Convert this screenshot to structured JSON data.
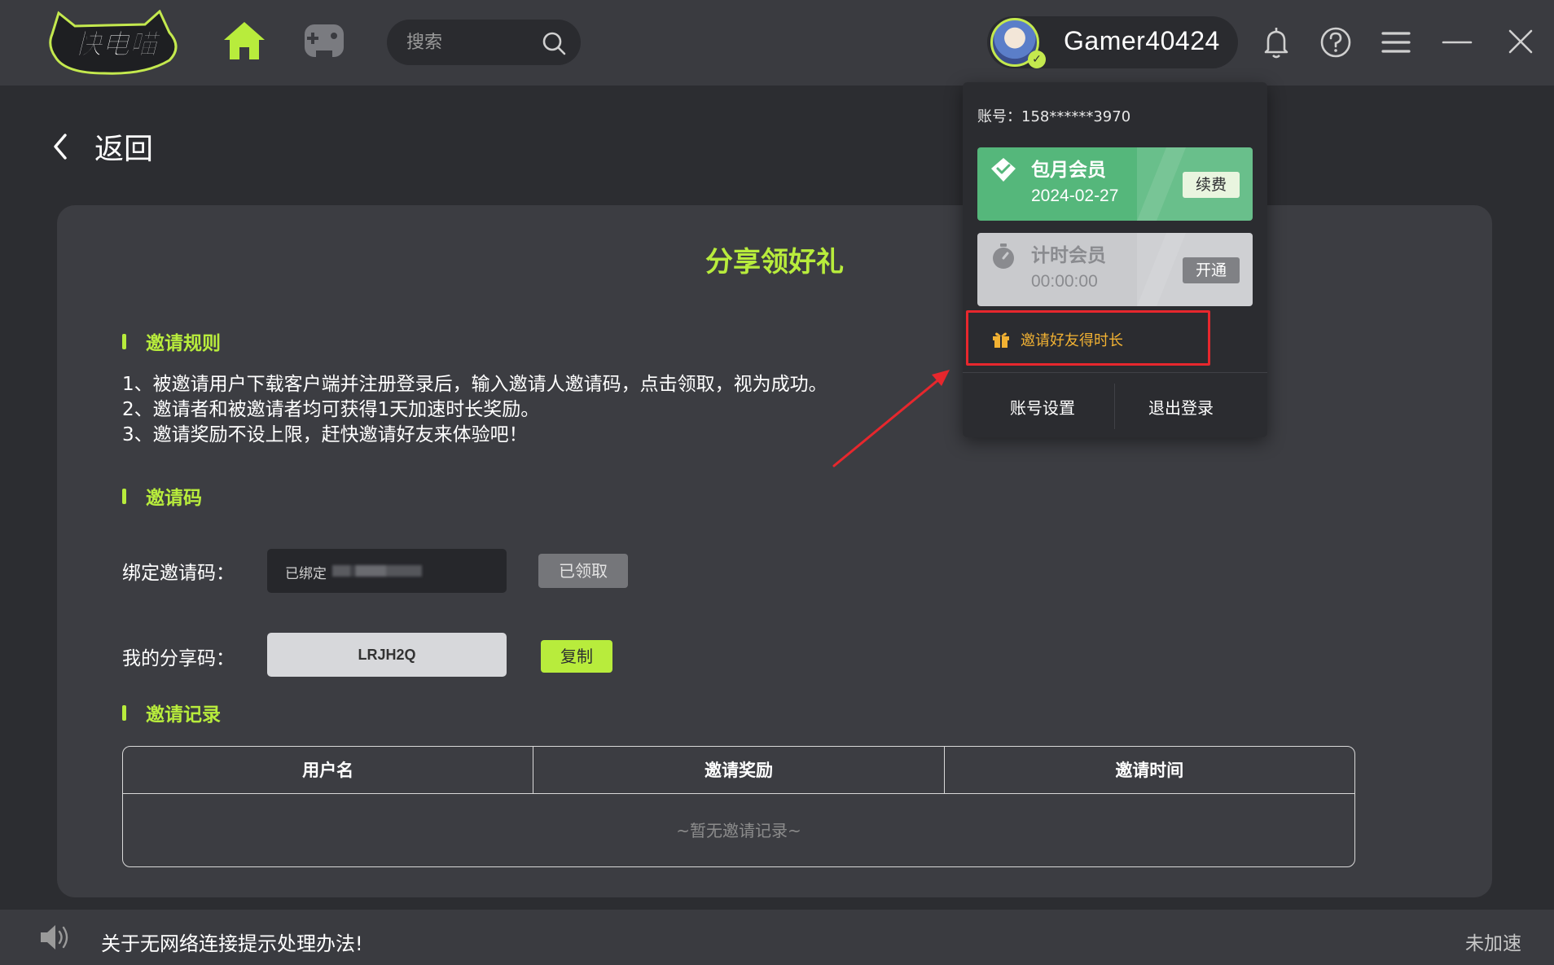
{
  "header": {
    "logo_text": "快电喵",
    "search_placeholder": "搜索",
    "username": "Gamer40424"
  },
  "back": {
    "label": "返回"
  },
  "page": {
    "title": "分享领好礼",
    "rules_heading": "邀请规则",
    "rules": [
      "1、被邀请用户下载客户端并注册登录后，输入邀请人邀请码，点击领取，视为成功。",
      "2、邀请者和被邀请者均可获得1天加速时长奖励。",
      "3、邀请奖励不设上限，赶快邀请好友来体验吧！"
    ],
    "code_heading": "邀请码",
    "bind_label": "绑定邀请码：",
    "bind_value": "已绑定",
    "claimed_button": "已领取",
    "share_label": "我的分享码：",
    "share_code": "LRJH2Q",
    "copy_button": "复制",
    "records_heading": "邀请记录",
    "table_columns": [
      "用户名",
      "邀请奖励",
      "邀请时间"
    ],
    "table_empty": "~暂无邀请记录~"
  },
  "dropdown": {
    "account": "账号：158******3970",
    "monthly": {
      "name": "包月会员",
      "date": "2024-02-27",
      "button": "续费"
    },
    "timed": {
      "name": "计时会员",
      "time": "00:00:00",
      "button": "开通"
    },
    "invite_label": "邀请好友得时长",
    "settings": "账号设置",
    "logout": "退出登录"
  },
  "footer": {
    "notice": "关于无网络连接提示处理办法!",
    "status": "未加速"
  },
  "colors": {
    "accent": "#b8ec3c",
    "monthly_card": "#55b77b",
    "highlight_box": "#e7272d",
    "invite_text": "#f2b233"
  }
}
